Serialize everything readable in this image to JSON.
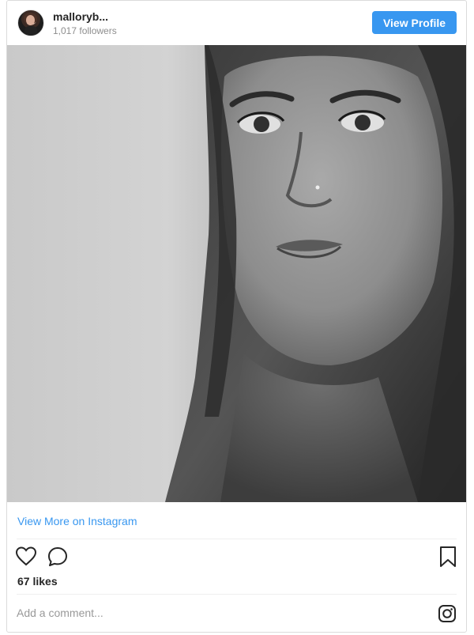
{
  "post": {
    "username": "malloryb...",
    "followers": "1,017 followers",
    "view_profile_label": "View Profile",
    "view_more_label": "View More on Instagram",
    "likes": "67 likes",
    "comment_placeholder": "Add a comment...",
    "image_style": "black-and-white portrait"
  },
  "icons": {
    "heart": "heart-icon",
    "comment": "comment-icon",
    "bookmark": "bookmark-icon",
    "instagram": "instagram-icon"
  },
  "colors": {
    "accent": "#3897f0",
    "text": "#262626",
    "secondary_text": "#8e8e8e",
    "border": "#dbdbdb"
  }
}
